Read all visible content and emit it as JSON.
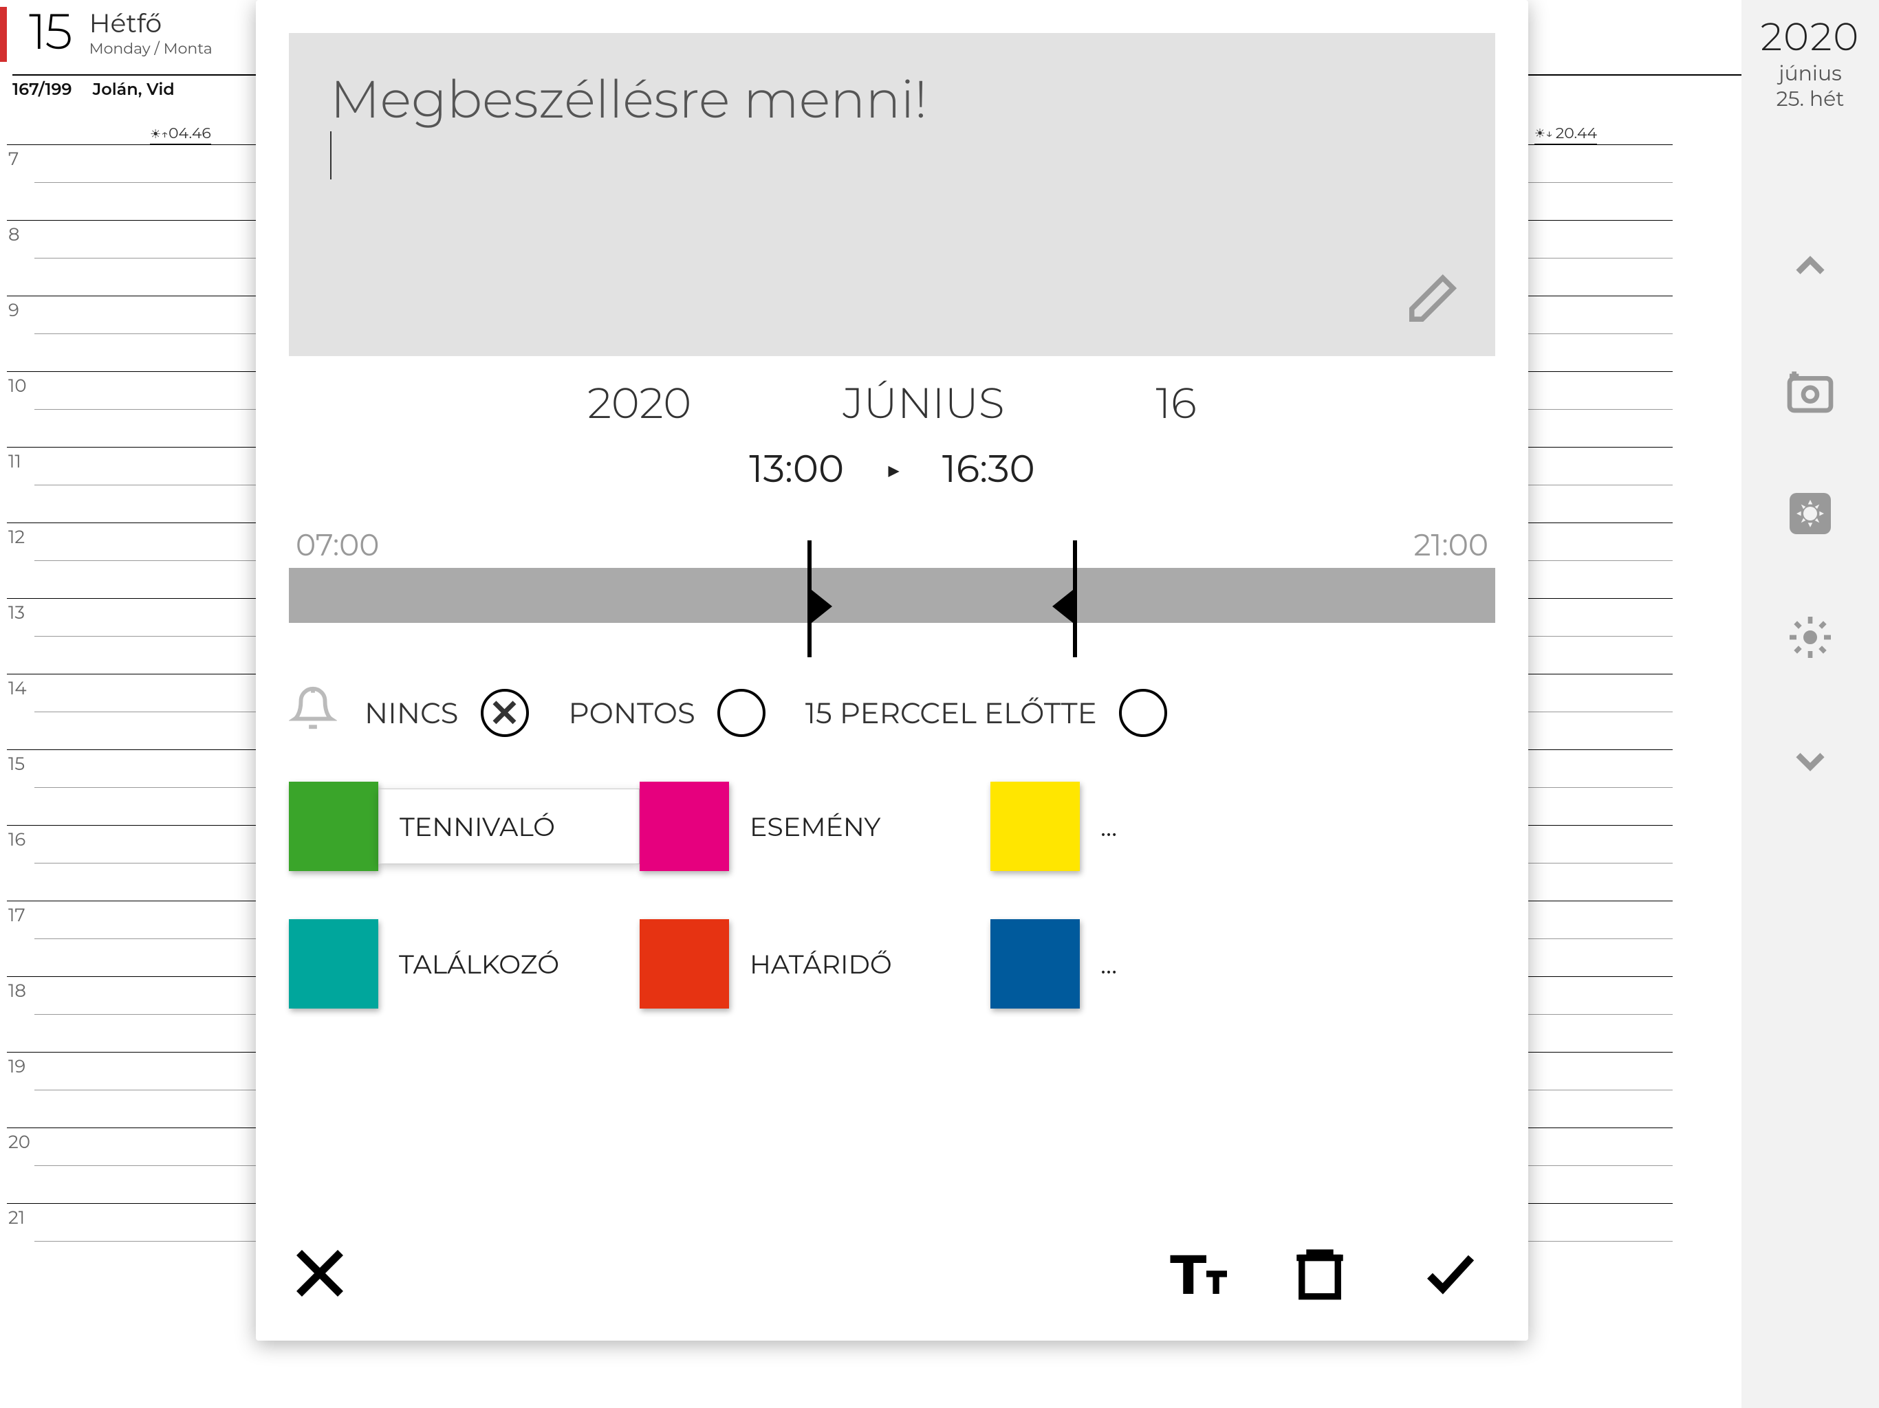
{
  "header": {
    "day_number": "15",
    "day_name": "Hétfő",
    "day_subname": "Monday / Monta",
    "day_count": "167/199",
    "names": "Jolán, Vid",
    "sunrise": "04.46",
    "sunset": "20.44"
  },
  "hours": [
    "7",
    "8",
    "9",
    "10",
    "11",
    "12",
    "13",
    "14",
    "15",
    "16",
    "17",
    "18",
    "19",
    "20",
    "21"
  ],
  "rail": {
    "year": "2020",
    "month": "június",
    "week": "25. hét"
  },
  "modal": {
    "note_text": "Megbeszéllésre menni!",
    "year": "2020",
    "month": "JÚNIUS",
    "day": "16",
    "start_time": "13:00",
    "end_time": "16:30",
    "slider_min": "07:00",
    "slider_max": "21:00",
    "alarm": {
      "opt_none": "NINCS",
      "opt_exact": "PONTOS",
      "opt_before": "15 PERCCEL ELŐTTE"
    },
    "categories": [
      {
        "color": "#3aa52a",
        "label": "TENNIVALÓ",
        "selected": true
      },
      {
        "color": "#e6007e",
        "label": "ESEMÉNY"
      },
      {
        "color": "#ffe600",
        "label": "..."
      },
      {
        "color": "#00a69c",
        "label": "TALÁLKOZÓ"
      },
      {
        "color": "#e63312",
        "label": "HATÁRIDŐ"
      },
      {
        "color": "#005a9c",
        "label": "..."
      }
    ]
  }
}
